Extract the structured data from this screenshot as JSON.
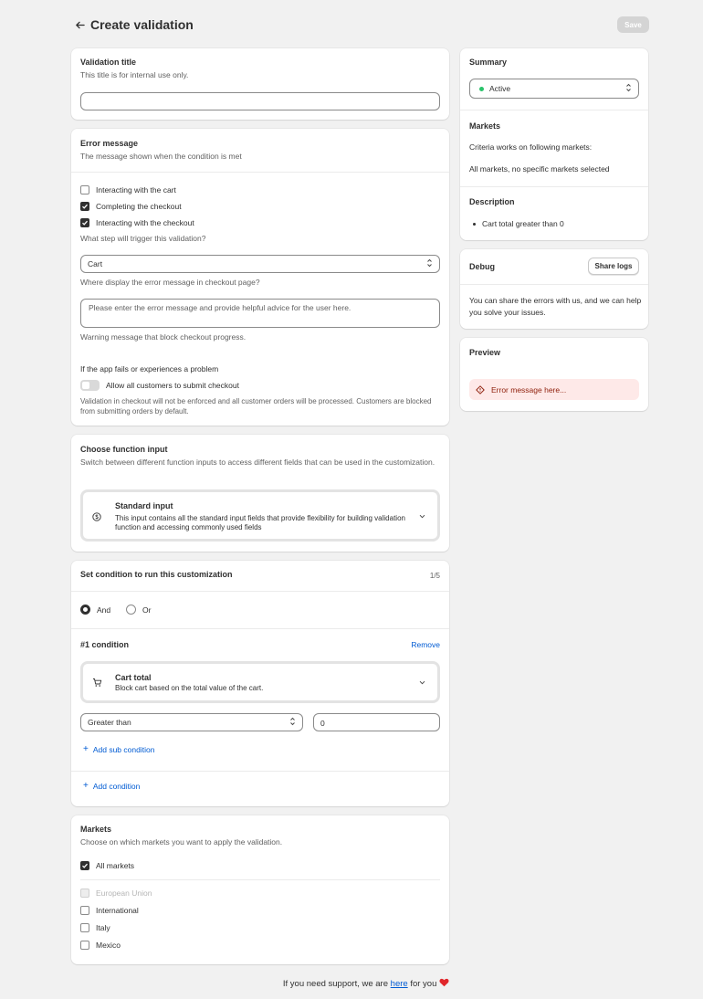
{
  "header": {
    "title": "Create validation",
    "save_label": "Save"
  },
  "validation_title": {
    "heading": "Validation title",
    "help": "This title is for internal use only.",
    "value": ""
  },
  "error_message": {
    "heading": "Error message",
    "help": "The message shown when the condition is met",
    "triggers": [
      {
        "label": "Interacting with the cart",
        "checked": false
      },
      {
        "label": "Completing the checkout",
        "checked": true
      },
      {
        "label": "Interacting with the checkout",
        "checked": true
      }
    ],
    "trigger_help": "What step will trigger this validation?",
    "display_select": "Cart",
    "display_help": "Where display the error message in checkout page?",
    "message_placeholder": "Please enter the error message and provide helpful advice for the user here.",
    "message_help": "Warning message that block checkout progress.",
    "fail_heading": "If the app fails or experiences a problem",
    "fail_toggle_label": "Allow all customers to submit checkout",
    "fail_help": "Validation in checkout will not be enforced and all customer orders will be processed. Customers are blocked from submitting orders by default."
  },
  "function_input": {
    "heading": "Choose function input",
    "help": "Switch between different function inputs to access different fields that can be used in the customization.",
    "option_title": "Standard input",
    "option_desc": "This input contains all the standard input fields that provide flexibility for building validation function and accessing commonly used fields"
  },
  "conditions": {
    "heading": "Set condition to run this customization",
    "count": "1/5",
    "and_label": "And",
    "or_label": "Or",
    "condition_title": "#1 condition",
    "remove_label": "Remove",
    "type_title": "Cart total",
    "type_desc": "Block cart based on the total value of the cart.",
    "operator": "Greater than",
    "value": "0",
    "add_sub": "Add sub condition",
    "add_condition": "Add condition"
  },
  "markets": {
    "heading": "Markets",
    "help": "Choose on which markets you want to apply the validation.",
    "all_label": "All markets",
    "items": [
      {
        "label": "European Union",
        "disabled": true
      },
      {
        "label": "International",
        "disabled": false
      },
      {
        "label": "Italy",
        "disabled": false
      },
      {
        "label": "Mexico",
        "disabled": false
      }
    ]
  },
  "summary": {
    "heading": "Summary",
    "status": "Active",
    "status_color": "#29c36a",
    "markets_heading": "Markets",
    "markets_line1": "Criteria works on following markets:",
    "markets_line2": "All markets, no specific markets selected",
    "description_heading": "Description",
    "description_item": "Cart total greater than 0"
  },
  "debug": {
    "heading": "Debug",
    "share_label": "Share logs",
    "text": "You can share the errors with us, and we can help you solve your issues."
  },
  "preview": {
    "heading": "Preview",
    "error_text": "Error message here..."
  },
  "footer": {
    "before": "If you need support, we are",
    "link": "here",
    "after": "for you"
  }
}
